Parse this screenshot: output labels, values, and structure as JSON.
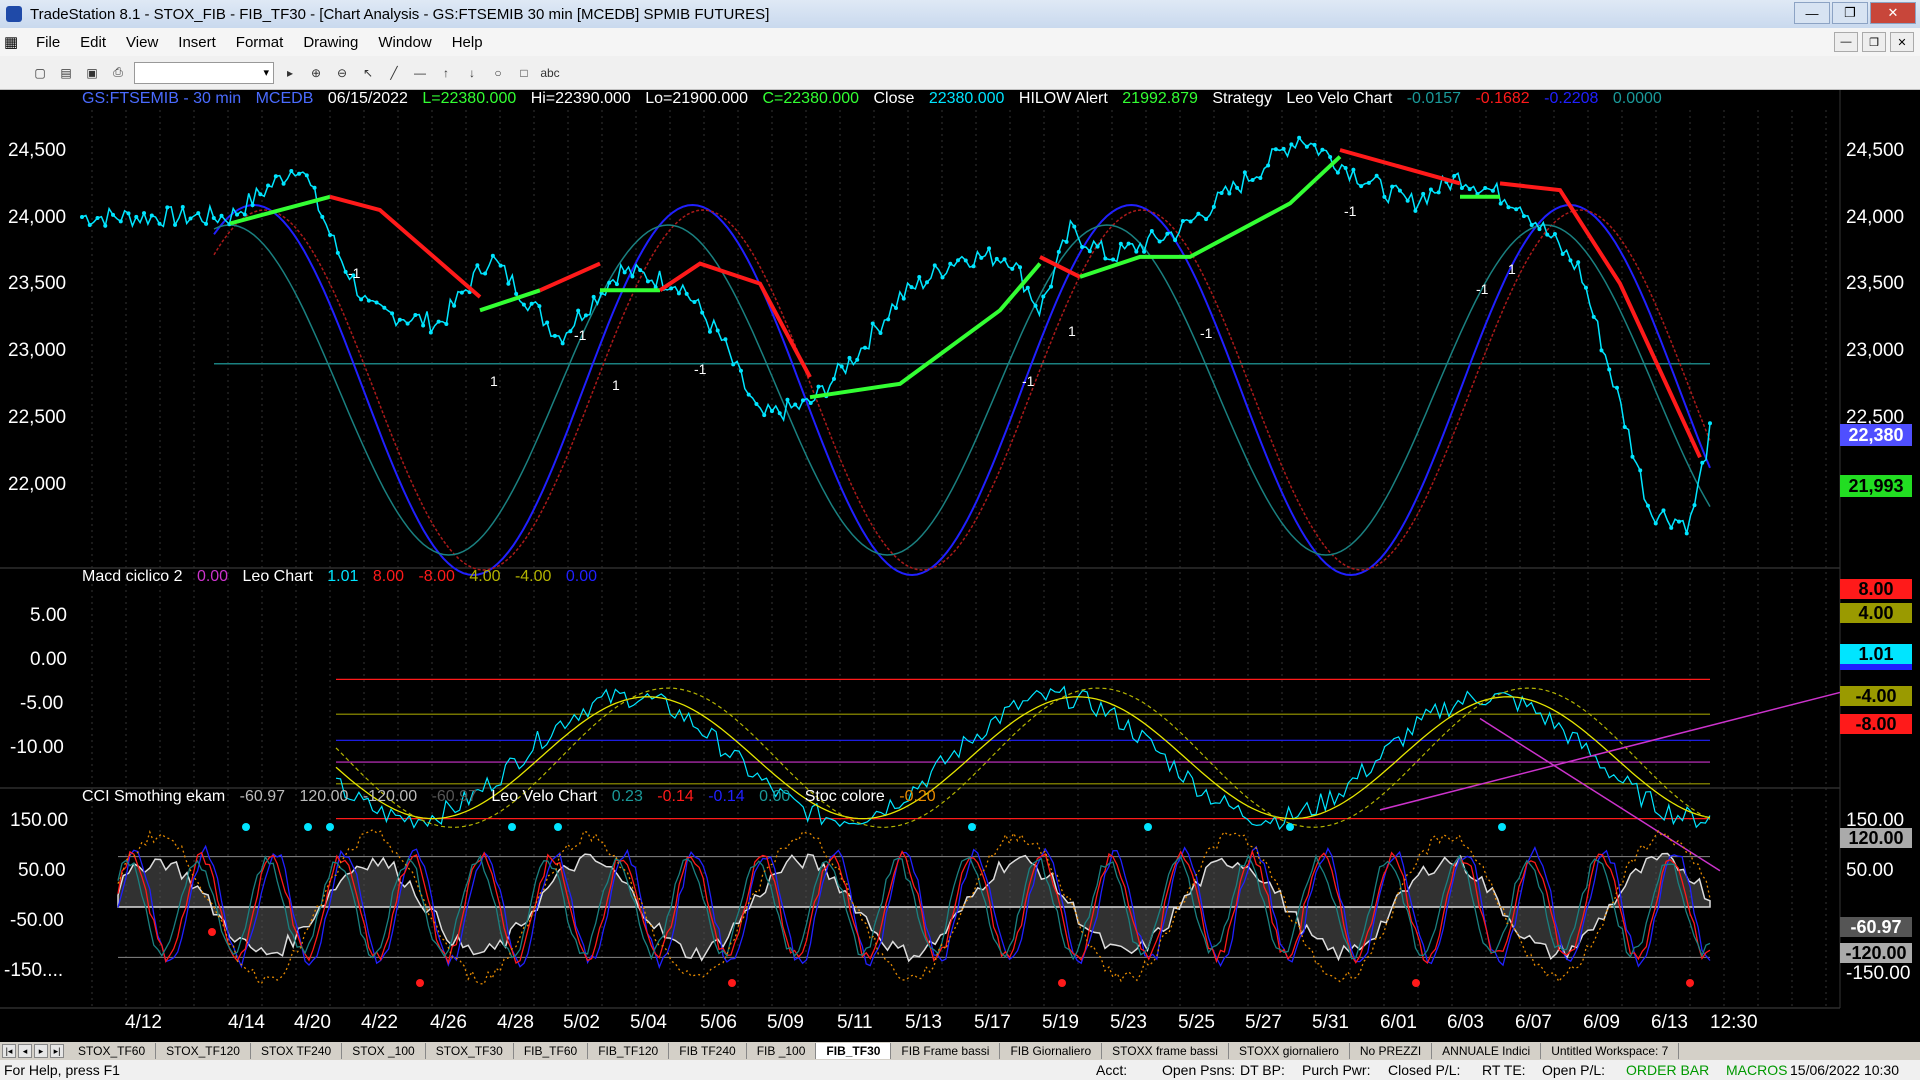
{
  "window": {
    "title": "TradeStation 8.1 - STOX_FIB - FIB_TF30 - [Chart Analysis - GS:FTSEMIB  30 min  [MCEDB] SPMIB FUTURES]",
    "min": "—",
    "max": "❐",
    "close": "✕"
  },
  "menu": [
    "File",
    "Edit",
    "View",
    "Insert",
    "Format",
    "Drawing",
    "Window",
    "Help"
  ],
  "header": {
    "symbol": "GS:FTSEMIB - 30 min",
    "feed": "MCEDB",
    "date": "06/15/2022",
    "low_last": "L=22380.000",
    "high": "Hi=22390.000",
    "low": "Lo=21900.000",
    "close_c": "C=22380.000",
    "close_label": "Close",
    "close_val": "22380.000",
    "hilow_label": "HILOW Alert",
    "hilow_val": "21992.879",
    "strategy": "Strategy",
    "leo_velo": "Leo Velo Chart",
    "v1": "-0.0157",
    "v2": "-0.1682",
    "v3": "-0.2208",
    "v4": "0.0000"
  },
  "macd_header": {
    "name": "Macd ciclico 2",
    "v0": "0.00",
    "leo": "Leo Chart",
    "v1": "1.01",
    "v2": "8.00",
    "v3": "-8.00",
    "v4": "4.00",
    "v5": "-4.00",
    "v6": "0.00"
  },
  "cci_header": {
    "name": "CCI Smothing ekam",
    "v1": "-60.97",
    "v2": "120.00",
    "v3": "-120.00",
    "v4": "-60.97",
    "leo": "Leo Velo Chart",
    "v5": "0.23",
    "v6": "-0.14",
    "v7": "-0.14",
    "v8": "0.00",
    "stoc": "Stoc colore",
    "v9": "-0.20"
  },
  "price_axis": [
    "24,500",
    "24,000",
    "23,500",
    "23,000",
    "22,500",
    "22,000"
  ],
  "price_axis_right": [
    "24,500",
    "24,000",
    "23,500",
    "23,000",
    "22,500"
  ],
  "price_tags": {
    "last": "22,380",
    "hilow": "21,993"
  },
  "macd_axis": [
    "5.00",
    "0.00",
    "-5.00",
    "-10.00"
  ],
  "macd_tags": {
    "t8": "8.00",
    "t5": "5.00",
    "t4": "4.00",
    "t1": "1.01",
    "tm4": "-4.00",
    "tm8": "-8.00",
    "tm10": "-10.00"
  },
  "cci_axis": [
    "150.00",
    "50.00",
    "-50.00",
    "-150...."
  ],
  "cci_tags": {
    "t150": "150.00",
    "t120": "120.00",
    "t50": "50.00",
    "tm50": "-50.00",
    "tm61": "-60.97",
    "tm120": "-120.00",
    "tm150": "-150.00"
  },
  "dates": [
    "4/12",
    "4/14",
    "4/20",
    "4/22",
    "4/26",
    "4/28",
    "5/02",
    "5/04",
    "5/06",
    "5/09",
    "5/11",
    "5/13",
    "5/17",
    "5/19",
    "5/23",
    "5/25",
    "5/27",
    "5/31",
    "6/01",
    "6/03",
    "6/07",
    "6/09",
    "6/13",
    "12:30"
  ],
  "signals": [
    "-1",
    "1",
    "-1",
    "1",
    "-1",
    "-1",
    "1",
    "-1",
    "-1",
    "1",
    "-1"
  ],
  "tabs": [
    "STOX_TF60",
    "STOX_TF120",
    "STOX TF240",
    "STOX _100",
    "STOX_TF30",
    "FIB_TF60",
    "FIB_TF120",
    "FIB TF240",
    "FIB _100",
    "FIB_TF30",
    "FIB Frame bassi",
    "FIB Giornaliero",
    "STOXX frame bassi",
    "STOXX giornaliero",
    "No PREZZI",
    "ANNUALE Indici",
    "Untitled Workspace: 7"
  ],
  "active_tab": "FIB_TF30",
  "status": {
    "help": "For Help, press F1",
    "acct": "Acct:",
    "open_psns": "Open Psns:",
    "dt_bp": "DT BP:",
    "purch_pwr": "Purch Pwr:",
    "closed_pl": "Closed P/L:",
    "rt_te": "RT TE:",
    "open_pl": "Open P/L:",
    "order_bar": "ORDER BAR",
    "macros": "MACROS",
    "datetime": "15/06/2022 10:30"
  },
  "colors": {
    "bg": "#000000",
    "price": "#00e5ff",
    "up": "#33ff33",
    "down": "#ff1a1a",
    "blue": "#2020ff",
    "teal": "#1a8080",
    "yellow": "#e6e600",
    "magenta": "#cc33cc"
  }
}
